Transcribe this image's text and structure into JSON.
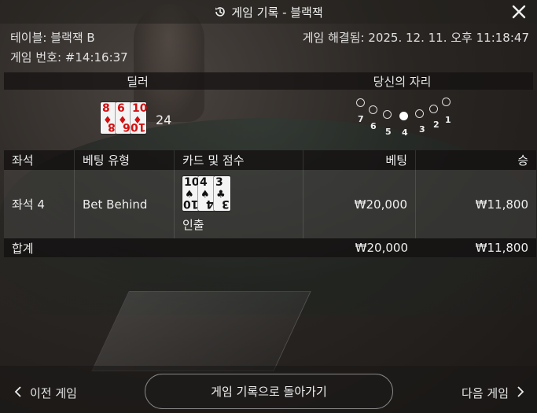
{
  "title": "게임 기록 - 블랙잭",
  "info": {
    "table": "테이블: 블랙잭 B",
    "resolved": "게임 해결됨: 2025. 12. 11. 오후 11:18:47",
    "game_number": "게임 번호: #14:16:37"
  },
  "dealer": {
    "label": "딜러",
    "cards": [
      {
        "rank": "8",
        "suit": "♦",
        "color": "#d11111"
      },
      {
        "rank": "6",
        "suit": "♦",
        "color": "#d11111"
      },
      {
        "rank": "10",
        "suit": "♦",
        "color": "#d11111"
      }
    ],
    "score": "24"
  },
  "seats": {
    "label": "당신의 자리",
    "numbers": [
      "7",
      "6",
      "5",
      "4",
      "3",
      "2",
      "1"
    ],
    "active_seat": "4"
  },
  "table": {
    "headers": [
      "좌석",
      "베팅 유형",
      "카드 및 점수",
      "베팅",
      "승"
    ],
    "rows": [
      {
        "seat": "좌석 4",
        "bet_type": "Bet Behind",
        "cards": [
          {
            "rank": "10",
            "suit": "♠",
            "color": "#111111"
          },
          {
            "rank": "4",
            "suit": "♠",
            "color": "#111111"
          },
          {
            "rank": "3",
            "suit": "♣",
            "color": "#111111"
          }
        ],
        "result": "인출",
        "bet": "₩20,000",
        "win": "₩11,800"
      }
    ],
    "total": {
      "label": "합계",
      "bet": "₩20,000",
      "win": "₩11,800"
    }
  },
  "nav": {
    "prev": "이전 게임",
    "back": "게임 기록으로 돌아가기",
    "next": "다음 게임"
  },
  "icons": {
    "title": "history-icon",
    "close": "close-icon",
    "prev": "chevron-left-icon",
    "next": "chevron-right-icon"
  }
}
